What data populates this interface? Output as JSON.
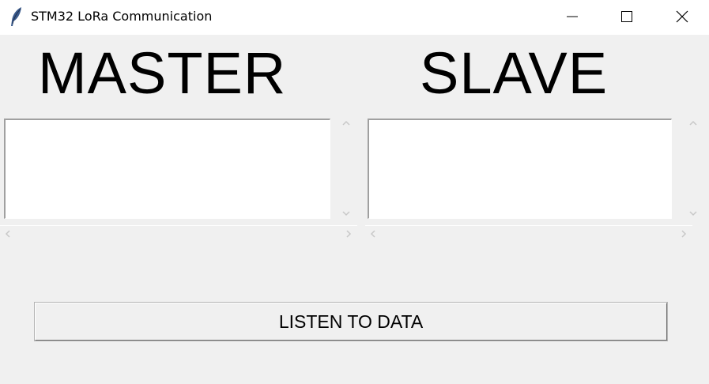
{
  "window": {
    "title": "STM32 LoRa Communication",
    "icon": "feather-icon",
    "controls": {
      "minimize_icon": "minimize-icon",
      "maximize_icon": "maximize-icon",
      "close_icon": "close-icon"
    }
  },
  "master": {
    "heading": "MASTER",
    "text_content": ""
  },
  "slave": {
    "heading": "SLAVE",
    "text_content": ""
  },
  "actions": {
    "listen_label": "LISTEN TO DATA"
  },
  "colors": {
    "background": "#f0f0f0",
    "titlebar": "#ffffff",
    "textbox": "#ffffff"
  }
}
